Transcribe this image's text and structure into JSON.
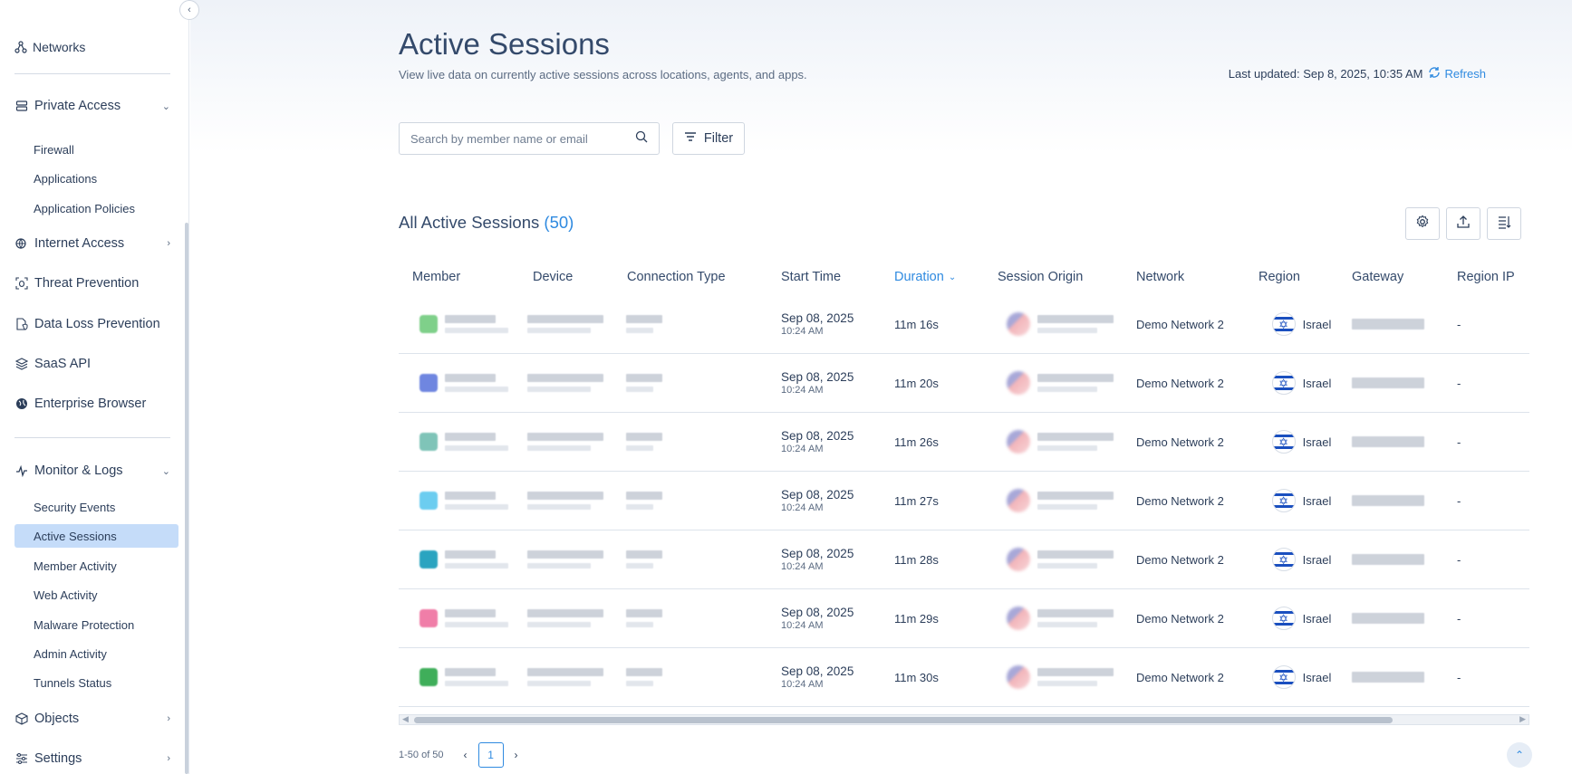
{
  "sidebar": {
    "top_item": "Networks",
    "items": [
      {
        "label": "Private Access",
        "icon": "server-icon",
        "expanded": true
      },
      {
        "label": "Internet Access",
        "icon": "globe-lock-icon",
        "expanded": false
      },
      {
        "label": "Threat Prevention",
        "icon": "bug-scan-icon"
      },
      {
        "label": "Data Loss Prevention",
        "icon": "file-shield-icon"
      },
      {
        "label": "SaaS API",
        "icon": "layers-icon"
      },
      {
        "label": "Enterprise Browser",
        "icon": "browser-globe-icon"
      },
      {
        "label": "Monitor & Logs",
        "icon": "pulse-icon",
        "expanded": true
      },
      {
        "label": "Objects",
        "icon": "cube-icon",
        "expanded": false
      },
      {
        "label": "Settings",
        "icon": "sliders-icon",
        "expanded": false
      }
    ],
    "private_access_sub": [
      "Firewall",
      "Applications",
      "Application Policies"
    ],
    "monitor_sub": [
      "Security Events",
      "Active Sessions",
      "Member Activity",
      "Web Activity",
      "Malware Protection",
      "Admin Activity",
      "Tunnels Status"
    ],
    "active_item": "Active Sessions"
  },
  "header": {
    "title": "Active Sessions",
    "subtitle": "View live data on currently active sessions across locations, agents, and apps.",
    "last_updated": "Last updated: Sep 8, 2025, 10:35 AM",
    "refresh_label": "Refresh"
  },
  "search": {
    "placeholder": "Search by member name or email",
    "value": ""
  },
  "filter_label": "Filter",
  "section": {
    "title": "All Active Sessions",
    "count": "(50)"
  },
  "columns": [
    "Member",
    "Device",
    "Connection Type",
    "Start Time",
    "Duration",
    "Session Origin",
    "Network",
    "Region",
    "Gateway",
    "Region IP"
  ],
  "sorted_column": "Duration",
  "rows": [
    {
      "start_date": "Sep 08, 2025",
      "start_time": "10:24 AM",
      "duration": "11m 16s",
      "network": "Demo Network 2",
      "region": "Israel",
      "region_ip": "-",
      "avatar_color": "#7fd08a"
    },
    {
      "start_date": "Sep 08, 2025",
      "start_time": "10:24 AM",
      "duration": "11m 20s",
      "network": "Demo Network 2",
      "region": "Israel",
      "region_ip": "-",
      "avatar_color": "#6f86e0"
    },
    {
      "start_date": "Sep 08, 2025",
      "start_time": "10:24 AM",
      "duration": "11m 26s",
      "network": "Demo Network 2",
      "region": "Israel",
      "region_ip": "-",
      "avatar_color": "#7fc4b8"
    },
    {
      "start_date": "Sep 08, 2025",
      "start_time": "10:24 AM",
      "duration": "11m 27s",
      "network": "Demo Network 2",
      "region": "Israel",
      "region_ip": "-",
      "avatar_color": "#6ccdf0"
    },
    {
      "start_date": "Sep 08, 2025",
      "start_time": "10:24 AM",
      "duration": "11m 28s",
      "network": "Demo Network 2",
      "region": "Israel",
      "region_ip": "-",
      "avatar_color": "#2aa4c0"
    },
    {
      "start_date": "Sep 08, 2025",
      "start_time": "10:24 AM",
      "duration": "11m 29s",
      "network": "Demo Network 2",
      "region": "Israel",
      "region_ip": "-",
      "avatar_color": "#f07ea8"
    },
    {
      "start_date": "Sep 08, 2025",
      "start_time": "10:24 AM",
      "duration": "11m 30s",
      "network": "Demo Network 2",
      "region": "Israel",
      "region_ip": "-",
      "avatar_color": "#3fae5a"
    }
  ],
  "pagination": {
    "range": "1-50 of 50",
    "current_page": "1"
  },
  "colors": {
    "accent": "#2f8ae0",
    "active_nav": "#c5dcf9",
    "israel_blue": "#1a4fbf"
  }
}
